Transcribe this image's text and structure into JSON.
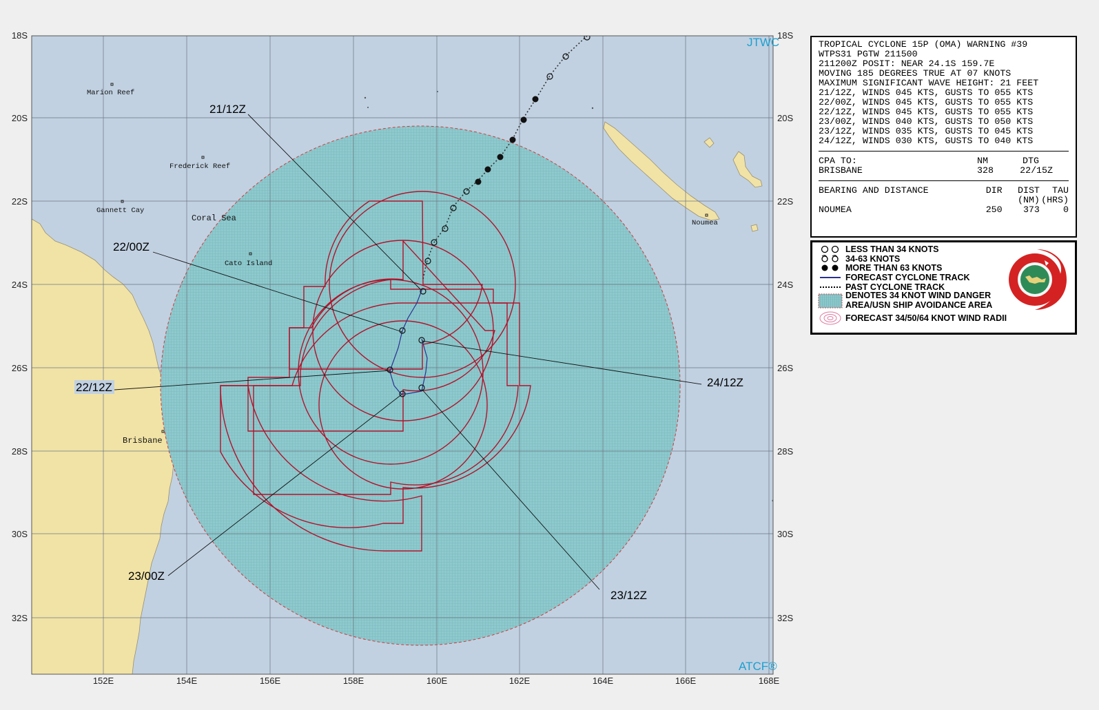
{
  "map": {
    "lat_labels": [
      "18S",
      "20S",
      "22S",
      "24S",
      "26S",
      "28S",
      "30S",
      "32S"
    ],
    "lon_labels": [
      "152E",
      "154E",
      "156E",
      "158E",
      "160E",
      "162E",
      "164E",
      "166E",
      "168E"
    ],
    "places": [
      "Marion Reef",
      "Frederick Reef",
      "Gannett Cay",
      "Coral Sea",
      "Cato Island",
      "Noumea",
      "Brisbane"
    ],
    "brand_top": "JTWC",
    "brand_bottom": "ATCF®",
    "forecast_times": [
      "21/12Z",
      "22/00Z",
      "22/12Z",
      "23/00Z",
      "23/12Z",
      "24/12Z"
    ],
    "colors": {
      "ocean": "#c1d1e1",
      "land": "#f1e3a6",
      "danger_area": "#8ec9cd",
      "wind_radii": "#b3132a",
      "forecast_track": "#2b2f8f"
    }
  },
  "info": {
    "lines": [
      "TROPICAL CYCLONE 15P (OMA) WARNING #39",
      "WTPS31 PGTW 211500",
      "211200Z POSIT: NEAR 24.1S 159.7E",
      "MOVING 185 DEGREES TRUE AT 07 KNOTS",
      "MAXIMUM SIGNIFICANT WAVE HEIGHT: 21 FEET",
      "21/12Z, WINDS 045 KTS, GUSTS TO 055 KTS",
      "22/00Z, WINDS 045 KTS, GUSTS TO 055 KTS",
      "22/12Z, WINDS 045 KTS, GUSTS TO 055 KTS",
      "23/00Z, WINDS 040 KTS, GUSTS TO 050 KTS",
      "23/12Z, WINDS 035 KTS, GUSTS TO 045 KTS",
      "24/12Z, WINDS 030 KTS, GUSTS TO 040 KTS"
    ],
    "cpa": {
      "label": "CPA TO:",
      "nm_header": "NM",
      "dtg_header": "DTG",
      "place": "BRISBANE",
      "nm": "328",
      "dtg": "22/15Z"
    },
    "bearing": {
      "label": "BEARING AND DISTANCE",
      "dir_header": "DIR",
      "dist_header": "DIST",
      "dist_unit": "(NM)",
      "tau_header": "TAU",
      "tau_unit": "(HRS)",
      "place": "NOUMEA",
      "dir": "250",
      "dist": "373",
      "tau": "0"
    }
  },
  "legend": {
    "items": [
      "LESS THAN 34 KNOTS",
      "34-63 KNOTS",
      "MORE THAN 63 KNOTS",
      "FORECAST CYCLONE TRACK",
      "PAST CYCLONE TRACK",
      "DENOTES 34 KNOT WIND DANGER AREA/USN SHIP AVOIDANCE AREA",
      "FORECAST 34/50/64 KNOT WIND RADII"
    ],
    "item6_line1": "DENOTES 34 KNOT WIND DANGER",
    "item6_line2": "AREA/USN SHIP AVOIDANCE AREA",
    "seal_text": "JOINT TYPHOON WARNING CENTER",
    "seal_sub": "PEARL HARBOR HAWAII"
  }
}
